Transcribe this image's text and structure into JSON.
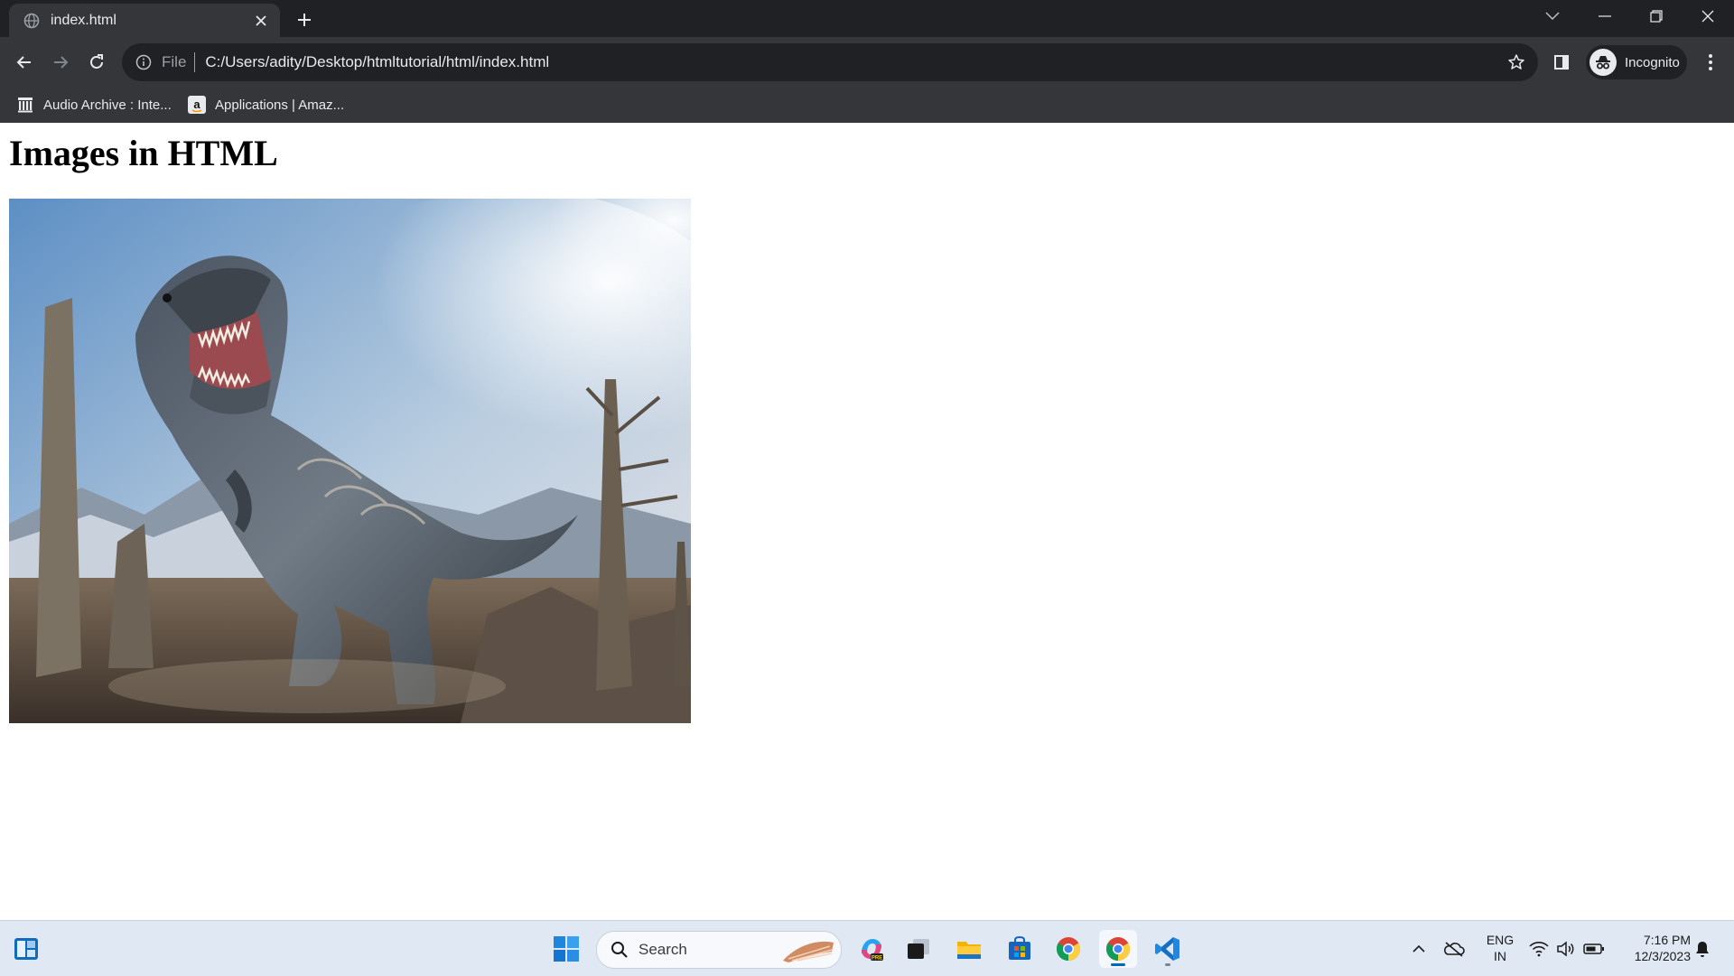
{
  "browser": {
    "tab": {
      "title": "index.html"
    },
    "address": {
      "scheme": "File",
      "url": "C:/Users/adity/Desktop/htmltutorial/html/index.html"
    },
    "profile": {
      "label": "Incognito"
    },
    "bookmarks": [
      {
        "label": "Audio Archive : Inte...",
        "icon": "archive-icon"
      },
      {
        "label": "Applications | Amaz...",
        "icon": "amazon-icon"
      }
    ]
  },
  "page": {
    "heading": "Images in HTML",
    "image": {
      "subject": "tyrannosaurus-rex-photo"
    }
  },
  "taskbar": {
    "search": {
      "label": "Search"
    },
    "language": {
      "line1": "ENG",
      "line2": "IN"
    },
    "clock": {
      "time": "7:16 PM",
      "date": "12/3/2023"
    },
    "apps": [
      "widgets-icon",
      "start-icon",
      "copilot-icon",
      "task-view-icon",
      "file-explorer-icon",
      "microsoft-store-icon",
      "chrome-icon",
      "chrome-incognito-icon",
      "vscode-icon"
    ]
  },
  "colors": {
    "titlebar": "#202124",
    "toolbar": "#35363a",
    "taskbar": "#dfe8f3",
    "accent": "#0067c0"
  }
}
